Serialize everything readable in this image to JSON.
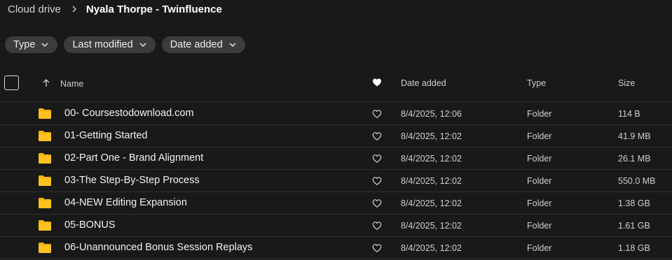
{
  "breadcrumb": {
    "root": "Cloud drive",
    "current": "Nyala Thorpe - Twinfluence"
  },
  "filters": [
    {
      "label": "Type"
    },
    {
      "label": "Last modified"
    },
    {
      "label": "Date added"
    }
  ],
  "table": {
    "headers": {
      "name": "Name",
      "date_added": "Date added",
      "type": "Type",
      "size": "Size"
    },
    "rows": [
      {
        "name": "00- Coursestodownload.com",
        "date_added": "8/4/2025, 12:06",
        "type": "Folder",
        "size": "114 B"
      },
      {
        "name": "01-Getting Started",
        "date_added": "8/4/2025, 12:02",
        "type": "Folder",
        "size": "41.9 MB"
      },
      {
        "name": "02-Part One - Brand Alignment",
        "date_added": "8/4/2025, 12:02",
        "type": "Folder",
        "size": "26.1 MB"
      },
      {
        "name": "03-The Step-By-Step Process",
        "date_added": "8/4/2025, 12:02",
        "type": "Folder",
        "size": "550.0 MB"
      },
      {
        "name": "04-NEW Editing Expansion",
        "date_added": "8/4/2025, 12:02",
        "type": "Folder",
        "size": "1.38 GB"
      },
      {
        "name": "05-BONUS",
        "date_added": "8/4/2025, 12:02",
        "type": "Folder",
        "size": "1.61 GB"
      },
      {
        "name": "06-Unannounced Bonus Session Replays",
        "date_added": "8/4/2025, 12:02",
        "type": "Folder",
        "size": "1.18 GB"
      }
    ]
  },
  "icons": {
    "folder": "folder-icon",
    "heart": "heart-icon",
    "sort": "sort-ascending-icon",
    "chevron": "chevron-down-icon",
    "separator": "chevron-right-icon"
  },
  "colors": {
    "background": "#191919",
    "chip": "#3c3c3c",
    "folder": "#f5b50d",
    "divider": "#2f2f2f"
  }
}
